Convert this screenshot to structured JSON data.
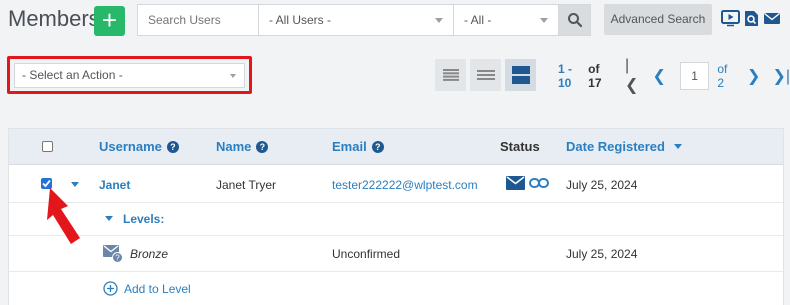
{
  "header": {
    "title": "Members",
    "add_icon": "plus-icon"
  },
  "search": {
    "placeholder": "Search Users",
    "users_filter": "- All Users -",
    "status_filter": "- All -",
    "advanced_label": "Advanced Search"
  },
  "top_icons": [
    "video-icon",
    "search-doc-icon",
    "email-icon"
  ],
  "actions": {
    "placeholder": "- Select an Action -"
  },
  "pagination": {
    "range": "1 - 10",
    "of_total": "of 17",
    "page": "1",
    "total_pages": "of 2"
  },
  "table": {
    "headers": {
      "username": "Username",
      "name": "Name",
      "email": "Email",
      "status": "Status",
      "date": "Date Registered"
    },
    "member": {
      "username": "Janet",
      "name": "Janet Tryer",
      "email": "tester222222@wlptest.com",
      "date": "July 25, 2024"
    },
    "levels_label": "Levels:",
    "level": {
      "name": "Bronze",
      "status": "Unconfirmed",
      "date": "July 25, 2024"
    },
    "add_level_label": "Add to Level"
  },
  "colors": {
    "accent": "#2b7fc0",
    "green": "#27b86a",
    "highlight": "#e3161b"
  }
}
